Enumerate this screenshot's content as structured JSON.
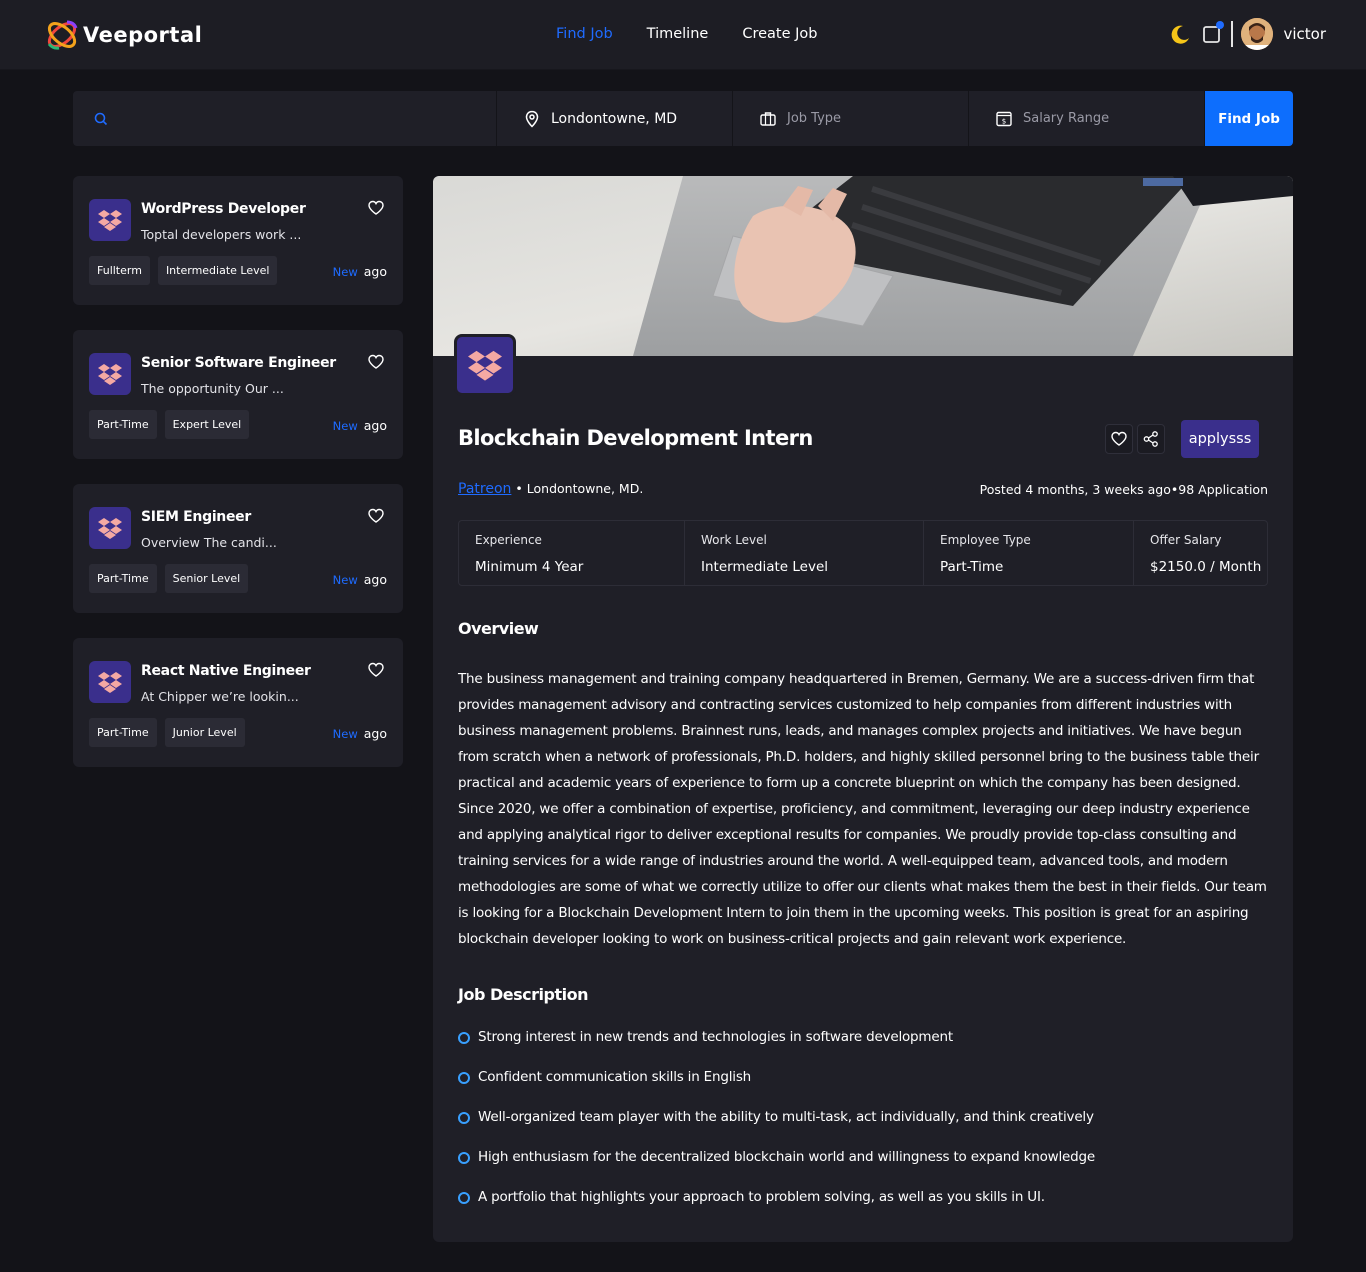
{
  "brand": {
    "name": "Veeportal"
  },
  "nav": {
    "items": [
      {
        "label": "Find Job",
        "active": true
      },
      {
        "label": "Timeline",
        "active": false
      },
      {
        "label": "Create Job",
        "active": false
      }
    ]
  },
  "user": {
    "name": "victor"
  },
  "search": {
    "placeholder": "",
    "location": "Londontowne, MD",
    "job_type": "Job Type",
    "salary_range": "Salary Range",
    "button": "Find Job"
  },
  "jobs": [
    {
      "title": "WordPress Developer",
      "subtitle": "Toptal developers work ...",
      "tags": [
        "Fullterm",
        "Intermediate Level"
      ],
      "new": "New",
      "ago": "ago"
    },
    {
      "title": "Senior Software Engineer",
      "subtitle": "The opportunity Our ...",
      "tags": [
        "Part-Time",
        "Expert Level"
      ],
      "new": "New",
      "ago": "ago"
    },
    {
      "title": "SIEM Engineer",
      "subtitle": "Overview The candi...",
      "tags": [
        "Part-Time",
        "Senior Level"
      ],
      "new": "New",
      "ago": "ago"
    },
    {
      "title": "React Native Engineer",
      "subtitle": "At Chipper we’re lookin...",
      "tags": [
        "Part-Time",
        "Junior Level"
      ],
      "new": "New",
      "ago": "ago"
    }
  ],
  "detail": {
    "title": "Blockchain Development Intern",
    "apply_label": "applysss",
    "company": "Patreon",
    "location": "Londontowne, MD.",
    "posted": "Posted 4 months, 3 weeks ago",
    "applications": "98 Application",
    "stats": [
      {
        "key": "Experience",
        "value": "Minimum 4 Year"
      },
      {
        "key": "Work Level",
        "value": "Intermediate Level"
      },
      {
        "key": "Employee Type",
        "value": "Part-Time"
      },
      {
        "key": "Offer Salary",
        "value": "$2150.0 / Month"
      }
    ],
    "overview_heading": "Overview",
    "overview": "The business management and training company headquartered in Bremen, Germany. We are a success-driven firm that provides management advisory and contracting services customized to help companies from different industries with business management problems. Brainnest runs, leads, and manages complex projects and initiatives. We have begun from scratch when a network of professionals, Ph.D. holders, and highly skilled personnel bring to the business table their practical and academic years of experience to form up a concrete blueprint on which the company has been designed. Since 2020, we offer a combination of expertise, proficiency, and commitment, leveraging our deep industry experience and applying analytical rigor to deliver exceptional results for companies. We proudly provide top-class consulting and training services for a wide range of industries around the world. A well-equipped team, advanced tools, and modern methodologies are some of what we correctly utilize to offer our clients what makes them the best in their fields. Our team is looking for a Blockchain Development Intern to join them in the upcoming weeks. This position is great for an aspiring blockchain developer looking to work on business-critical projects and gain relevant work experience.",
    "description_heading": "Job Description",
    "requirements": [
      "Strong interest in new trends and technologies in software development",
      "Confident communication skills in English",
      "Well-organized team player with the ability to multi-task, act individually, and think creatively",
      "High enthusiasm for the decentralized blockchain world and willingness to expand knowledge",
      "A portfolio that highlights your approach to problem solving, as well as you skills in UI."
    ]
  },
  "colors": {
    "accent": "#1f6bff",
    "primary_btn": "#0d6efd",
    "brand_purple": "#3a2f8c",
    "card_bg": "#1f1f27",
    "page_bg": "#131318"
  }
}
